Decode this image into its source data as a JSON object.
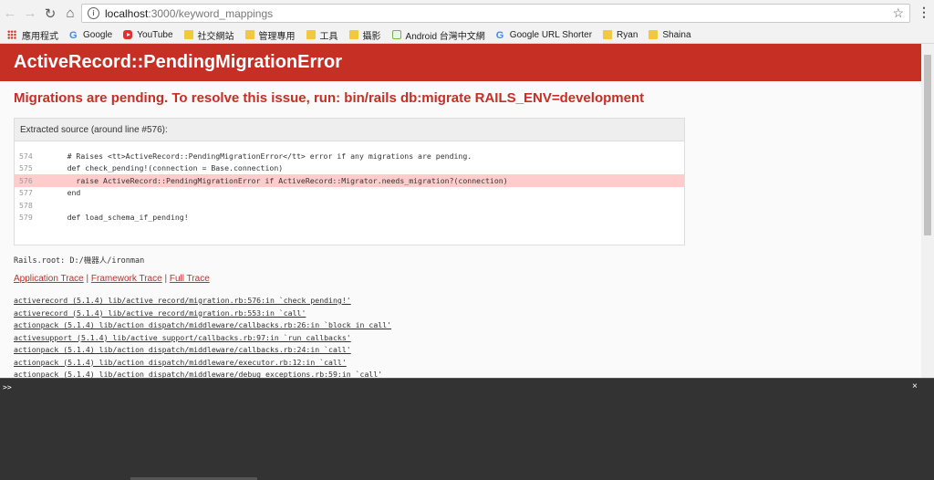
{
  "browser": {
    "url_host": "localhost",
    "url_path": ":3000/keyword_mappings",
    "bookmarks": [
      {
        "label": "應用程式",
        "icon": "apps-grid-icon"
      },
      {
        "label": "Google",
        "icon": "google-icon"
      },
      {
        "label": "YouTube",
        "icon": "youtube-icon"
      },
      {
        "label": "社交網站",
        "icon": "folder-icon"
      },
      {
        "label": "管理專用",
        "icon": "folder-icon"
      },
      {
        "label": "工具",
        "icon": "folder-icon"
      },
      {
        "label": "攝影",
        "icon": "folder-icon"
      },
      {
        "label": "Android 台灣中文網",
        "icon": "android-icon"
      },
      {
        "label": "Google URL Shorter",
        "icon": "google-icon"
      },
      {
        "label": "Ryan",
        "icon": "folder-icon"
      },
      {
        "label": "Shaina",
        "icon": "folder-icon"
      }
    ]
  },
  "error": {
    "title": "ActiveRecord::PendingMigrationError",
    "message": "Migrations are pending. To resolve this issue, run: bin/rails db:migrate RAILS_ENV=development"
  },
  "source": {
    "title": "Extracted source (around line #576):",
    "lines": [
      {
        "num": "574",
        "text": "      # Raises <tt>ActiveRecord::PendingMigrationError</tt> error if any migrations are pending.",
        "highlight": false
      },
      {
        "num": "575",
        "text": "      def check_pending!(connection = Base.connection)",
        "highlight": false
      },
      {
        "num": "576",
        "text": "        raise ActiveRecord::PendingMigrationError if ActiveRecord::Migrator.needs_migration?(connection)",
        "highlight": true
      },
      {
        "num": "577",
        "text": "      end",
        "highlight": false
      },
      {
        "num": "578",
        "text": "",
        "highlight": false
      },
      {
        "num": "579",
        "text": "      def load_schema_if_pending!",
        "highlight": false
      }
    ]
  },
  "rails_root": "Rails.root: D:/機器人/ironman",
  "trace_links": {
    "application": "Application Trace",
    "separator": "|",
    "framework": "Framework Trace",
    "full": "Full Trace"
  },
  "trace": [
    "activerecord (5.1.4) lib/active_record/migration.rb:576:in `check_pending!'",
    "activerecord (5.1.4) lib/active_record/migration.rb:553:in `call'",
    "actionpack (5.1.4) lib/action_dispatch/middleware/callbacks.rb:26:in `block in call'",
    "activesupport (5.1.4) lib/active_support/callbacks.rb:97:in `run_callbacks'",
    "actionpack (5.1.4) lib/action_dispatch/middleware/callbacks.rb:24:in `call'",
    "actionpack (5.1.4) lib/action_dispatch/middleware/executor.rb:12:in `call'",
    "actionpack (5.1.4) lib/action_dispatch/middleware/debug_exceptions.rb:59:in `call'"
  ],
  "console": {
    "prompt": ">>",
    "close": "×"
  },
  "colors": {
    "header_red": "#c52f24",
    "highlight_line": "#ffcccc",
    "console_bg": "#333333"
  }
}
